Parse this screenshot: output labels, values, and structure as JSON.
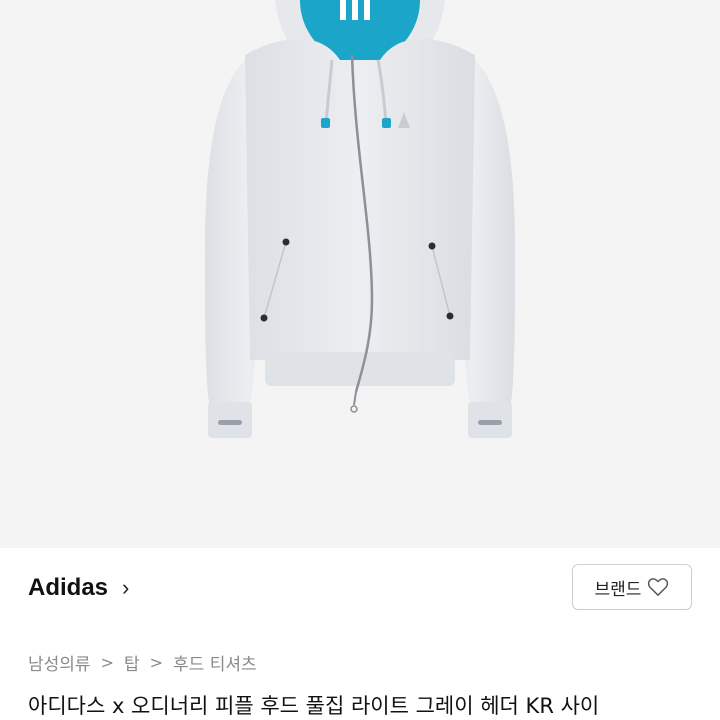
{
  "brand": {
    "name": "Adidas",
    "chevron": "›",
    "follow_label": "브랜드",
    "follow_icon": "heart-outline-icon"
  },
  "breadcrumb": [
    {
      "label": "남성의류"
    },
    {
      "label": "탑"
    },
    {
      "label": "후드 티셔츠"
    }
  ],
  "breadcrumb_separator": ">",
  "product": {
    "title": "아디다스 x 오디너리 피플 후드 풀집 라이트 그레이 헤더 KR 사이"
  },
  "colors": {
    "hoodie": "#e4e6ea",
    "hood_lining": "#1aa5c9",
    "image_bg": "#f4f4f4"
  }
}
